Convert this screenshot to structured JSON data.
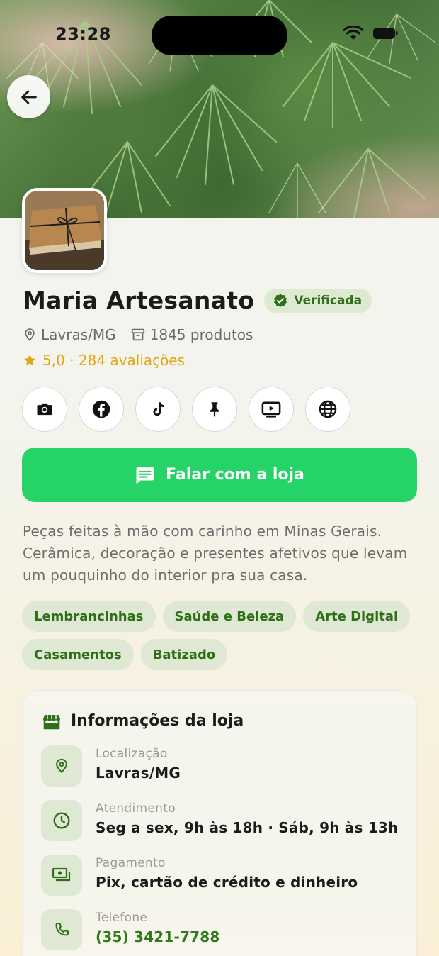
{
  "status_bar": {
    "time": "23:28"
  },
  "store": {
    "name": "Maria Artesanato",
    "verified_label": "Verificada",
    "location": "Lavras/MG",
    "products": "1845 produtos",
    "rating": "5,0 · 284 avaliações"
  },
  "social": [
    {
      "name": "instagram-icon"
    },
    {
      "name": "facebook-icon"
    },
    {
      "name": "tiktok-icon"
    },
    {
      "name": "pinterest-icon"
    },
    {
      "name": "youtube-icon"
    },
    {
      "name": "website-icon"
    }
  ],
  "cta": {
    "label": "Falar com a loja"
  },
  "description": "Peças feitas à mão com carinho em Minas Gerais. Cerâmica, decoração e presentes afetivos que levam um pouquinho do interior pra sua casa.",
  "tags": [
    "Lembrancinhas",
    "Saúde e Beleza",
    "Arte Digital",
    "Casamentos",
    "Batizado"
  ],
  "info": {
    "title": "Informações da loja",
    "rows": [
      {
        "label": "Localização",
        "value": "Lavras/MG"
      },
      {
        "label": "Atendimento",
        "value": "Seg a sex, 9h às 18h · Sáb, 9h às 13h"
      },
      {
        "label": "Pagamento",
        "value": "Pix, cartão de crédito e dinheiro"
      },
      {
        "label": "Telefone",
        "value": "(35) 3421-7788"
      }
    ]
  },
  "colors": {
    "accent_green": "#2f6f1a",
    "cta_green": "#25d366",
    "rating_gold": "#e0a615",
    "tag_bg": "#dfe8d3"
  }
}
